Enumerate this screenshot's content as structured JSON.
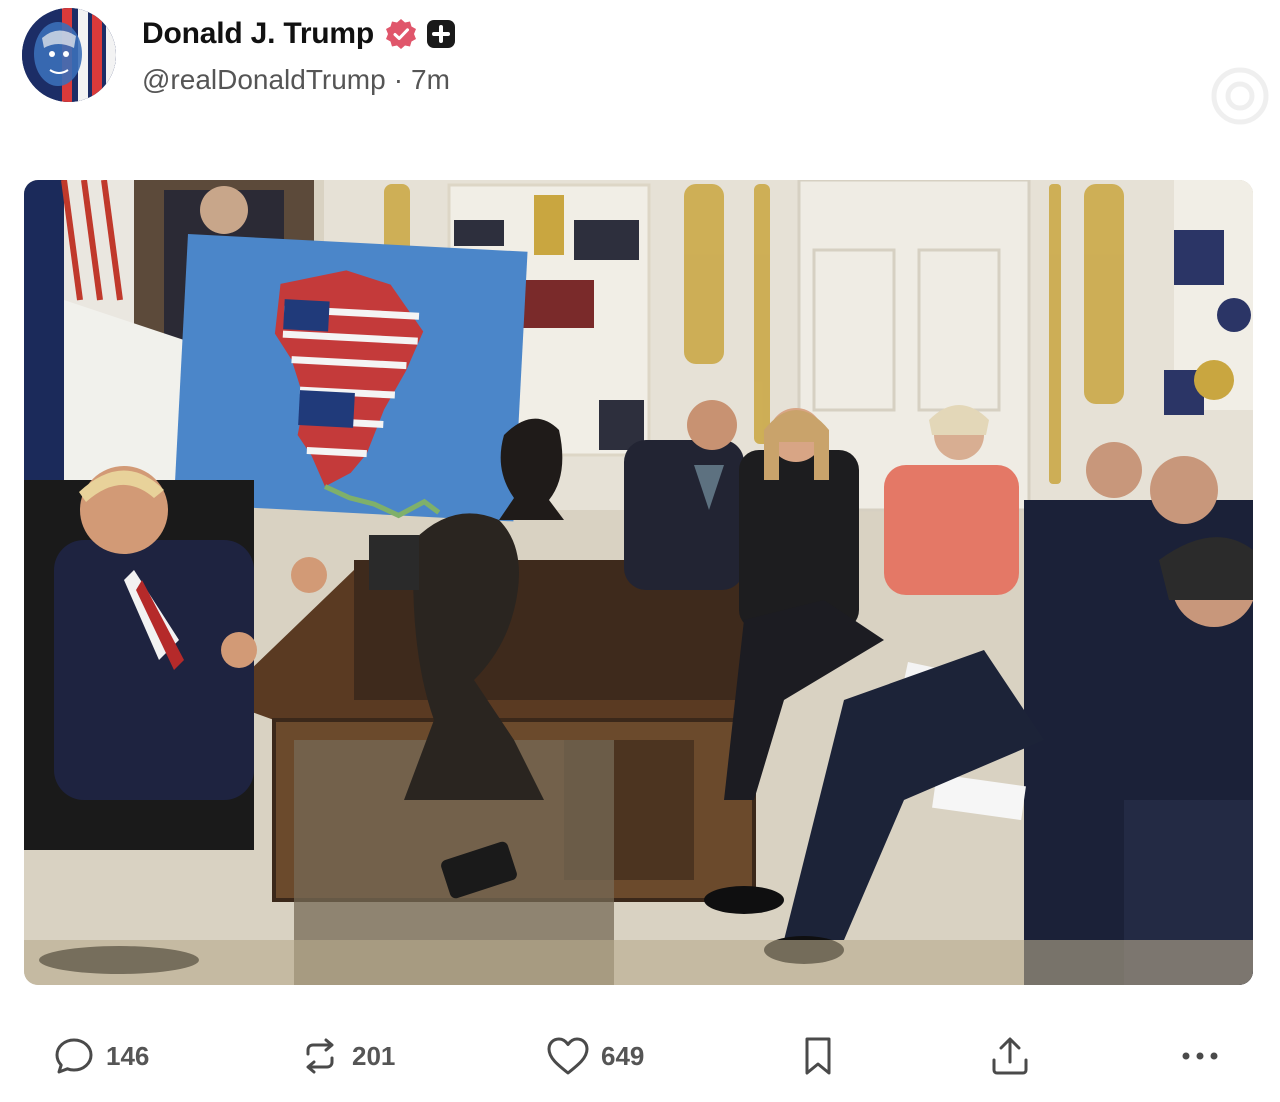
{
  "post": {
    "author": {
      "display_name": "Donald J. Trump",
      "handle": "@realDonaldTrump",
      "time": "7m",
      "separator": "·"
    },
    "image": {
      "alt": ""
    }
  },
  "actions": {
    "replies": "146",
    "reposts": "201",
    "likes": "649"
  },
  "icons": {
    "verified": "verified-badge-icon",
    "plus": "plus-badge-icon",
    "reply": "reply-icon",
    "repost": "repost-icon",
    "like": "heart-icon",
    "bookmark": "bookmark-icon",
    "share": "share-icon",
    "more": "more-icon"
  },
  "colors": {
    "verified": "#e0566b",
    "text": "#111111",
    "muted": "#555555"
  }
}
